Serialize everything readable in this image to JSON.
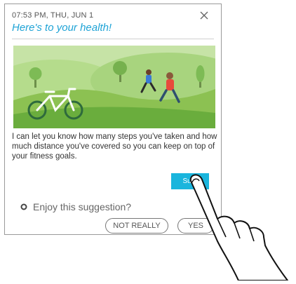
{
  "notification": {
    "timestamp": "07:53 PM, THU, JUN 1",
    "title": "Here's to your health!",
    "message": "I can let you know how many steps you've taken and how much distance you've covered so you can keep on top of your fitness goals.",
    "action_label": "Sure",
    "close_icon": "close-icon"
  },
  "feedback": {
    "question": "Enjoy this suggestion?",
    "no_label": "NOT REALLY",
    "yes_label": "YES"
  },
  "colors": {
    "accent": "#1fa3d6",
    "button": "#1ab5dd",
    "illustration_green": "#8cc152"
  }
}
